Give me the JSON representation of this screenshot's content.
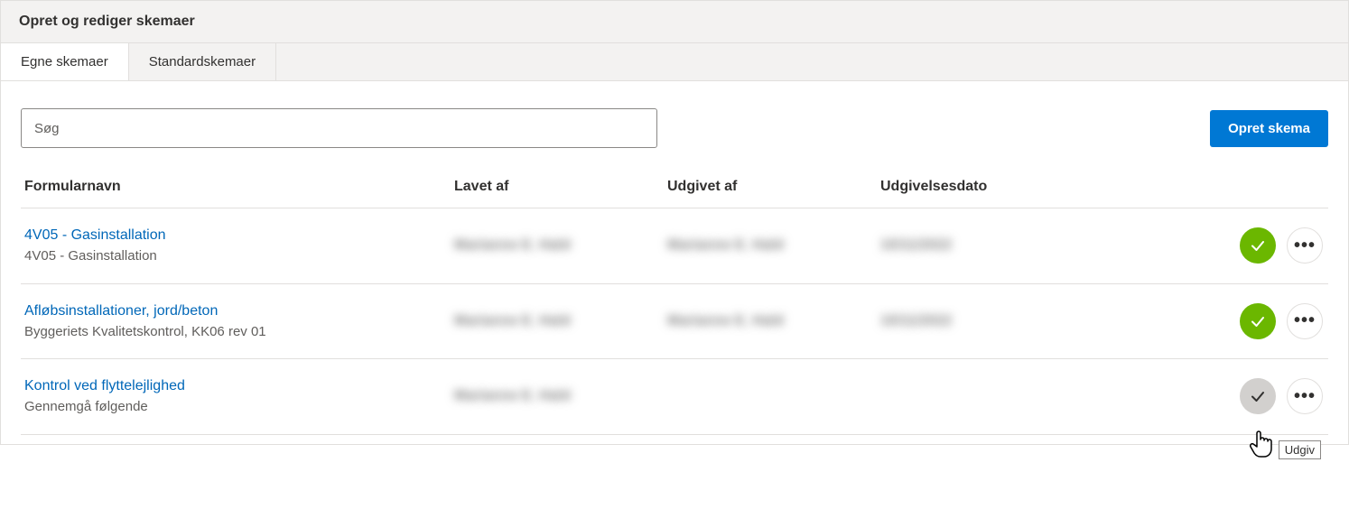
{
  "header": {
    "title": "Opret og rediger skemaer"
  },
  "tabs": [
    {
      "label": "Egne skemaer",
      "active": true
    },
    {
      "label": "Standardskemaer",
      "active": false
    }
  ],
  "toolbar": {
    "search_placeholder": "Søg",
    "create_label": "Opret skema"
  },
  "table": {
    "columns": {
      "name": "Formularnavn",
      "creator": "Lavet af",
      "publisher": "Udgivet af",
      "date": "Udgivelsesdato"
    },
    "rows": [
      {
        "title": "4V05 - Gasinstallation",
        "subtitle": "4V05 - Gasinstallation",
        "creator": "Marianne E. Hald",
        "publisher": "Marianne E. Hald",
        "date": "10/11/2022",
        "published": true
      },
      {
        "title": "Afløbsinstallationer, jord/beton",
        "subtitle": "Byggeriets Kvalitetskontrol, KK06 rev 01",
        "creator": "Marianne E. Hald",
        "publisher": "Marianne E. Hald",
        "date": "10/11/2022",
        "published": true
      },
      {
        "title": "Kontrol ved flyttelejlighed",
        "subtitle": "Gennemgå følgende",
        "creator": "Marianne E. Hald",
        "publisher": "",
        "date": "",
        "published": false
      }
    ]
  },
  "tooltip": {
    "publish": "Udgiv"
  }
}
